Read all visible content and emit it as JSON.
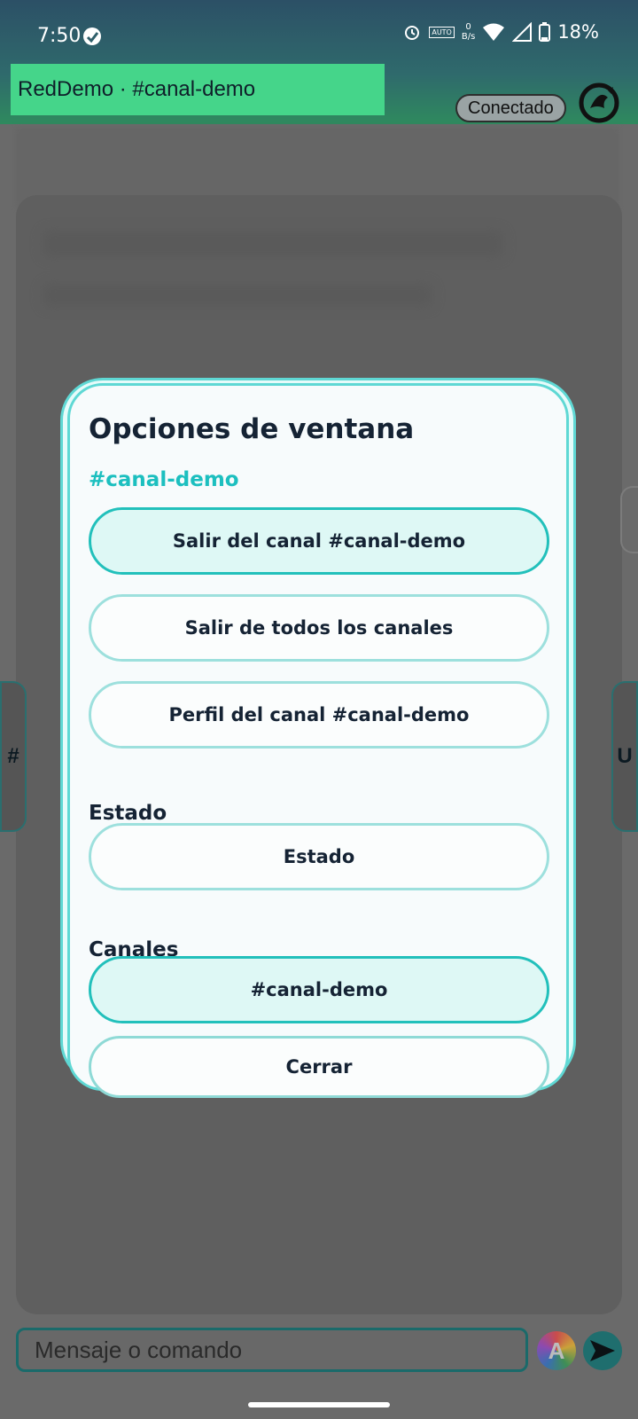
{
  "status_bar": {
    "time": "7:50",
    "speed_value": "0",
    "speed_unit": "B/s",
    "auto_label": "AUTO",
    "battery": "18%"
  },
  "header": {
    "title": "RedDemo · #canal-demo",
    "connection_status": "Conectado"
  },
  "side_tabs": {
    "left": "#",
    "right": "U"
  },
  "dialog": {
    "title": "Opciones de ventana",
    "subtitle": "#canal-demo",
    "buttons": {
      "leave_channel": "Salir del canal #canal-demo",
      "leave_all": "Salir de todos los canales",
      "channel_profile": "Perfil del canal #canal-demo"
    },
    "section_status": "Estado",
    "status_button": "Estado",
    "section_channels": "Canales",
    "channel_item": "#canal-demo",
    "close": "Cerrar"
  },
  "composer": {
    "placeholder": "Mensaje o comando",
    "format_button": "A"
  },
  "colors": {
    "accent": "#1cbfbf",
    "title_bg": "#45d58a",
    "dialog_bg": "#f7fbfc"
  }
}
